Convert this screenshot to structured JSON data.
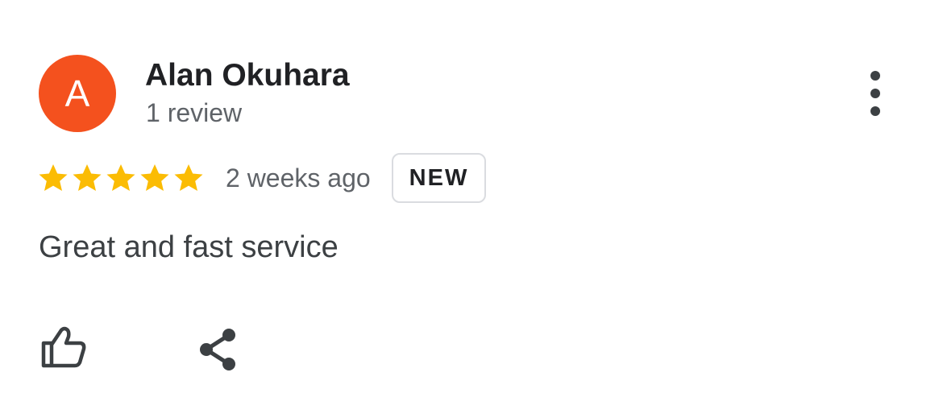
{
  "reviewer": {
    "avatar_letter": "A",
    "avatar_color": "#F4511E",
    "name": "Alan Okuhara",
    "review_count": "1 review"
  },
  "review": {
    "rating": 5,
    "max_rating": 5,
    "star_color": "#FBBC04",
    "date": "2 weeks ago",
    "badge": "NEW",
    "text": "Great and fast service"
  },
  "actions": {
    "more_icon": "more-vertical-icon",
    "like_icon": "thumb-up-icon",
    "share_icon": "share-icon"
  }
}
